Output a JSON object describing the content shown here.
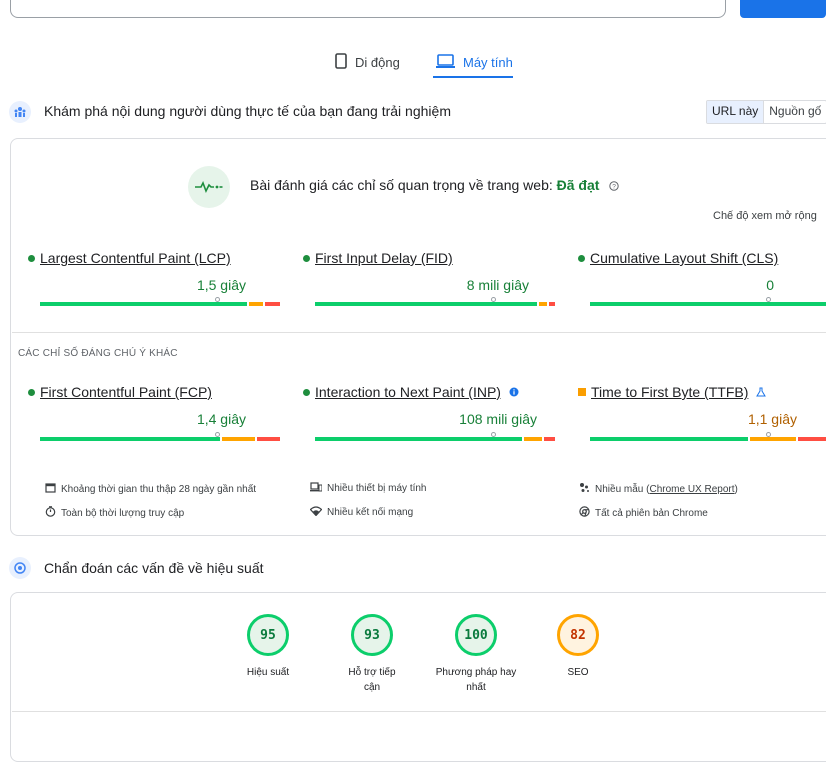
{
  "tabs": {
    "mobile": "Di động",
    "desktop": "Máy tính"
  },
  "field": {
    "heading": "Khám phá nội dung người dùng thực tế của bạn đang trải nghiệm",
    "toggle_url": "URL này",
    "toggle_origin": "Nguồn gố",
    "assessment_prefix": "Bài đánh giá các chỉ số quan trọng về trang web: ",
    "assessment_result": "Đã đạt",
    "expand_view": "Chế độ xem mở rộng",
    "other_metrics_title": "CÁC CHỈ SỐ ĐÁNG CHÚ Ý KHÁC"
  },
  "core_metrics": [
    {
      "name": "Largest Contentful Paint (LCP)",
      "value": "1,5 giây",
      "status": "good",
      "value_color": "#188038"
    },
    {
      "name": "First Input Delay (FID)",
      "value": "8 mili giây",
      "status": "good",
      "value_color": "#188038"
    },
    {
      "name": "Cumulative Layout Shift (CLS)",
      "value": "0",
      "status": "good",
      "value_color": "#188038"
    }
  ],
  "other_metrics": [
    {
      "name": "First Contentful Paint (FCP)",
      "value": "1,4 giây",
      "status": "good",
      "value_color": "#188038"
    },
    {
      "name": "Interaction to Next Paint (INP)",
      "value": "108 mili giây",
      "status": "good",
      "value_color": "#188038"
    },
    {
      "name": "Time to First Byte (TTFB)",
      "value": "1,1 giây",
      "status": "average",
      "value_color": "#b06000"
    }
  ],
  "info": {
    "period": "Khoảng thời gian thu thập 28 ngày gần nhất",
    "devices": "Nhiều thiết bị máy tính",
    "samples_prefix": "Nhiều mẫu (",
    "samples_link": "Chrome UX Report",
    "samples_suffix": ")",
    "duration": "Toàn bộ thời lượng truy cập",
    "network": "Nhiều kết nối mạng",
    "versions": "Tất cả phiên bản Chrome"
  },
  "diagnose": {
    "heading": "Chẩn đoán các vấn đề về hiệu suất"
  },
  "scores": [
    {
      "value": "95",
      "label": "Hiệu suất",
      "rating": "good"
    },
    {
      "value": "93",
      "label": "Hỗ trợ tiếp cận",
      "rating": "good"
    },
    {
      "value": "100",
      "label": "Phương pháp hay nhất",
      "rating": "good"
    },
    {
      "value": "82",
      "label": "SEO",
      "rating": "average"
    }
  ],
  "colors": {
    "accent": "#1a73e8",
    "good": "#0cce6b",
    "average": "#ffa400",
    "poor": "#ff4e42"
  },
  "icons": [
    "smartphone-icon",
    "laptop-icon",
    "people-icon",
    "heartbeat-icon",
    "help-icon",
    "info-icon",
    "flask-icon",
    "calendar-icon",
    "devices-icon",
    "samples-icon",
    "timer-icon",
    "wifi-icon",
    "chrome-icon",
    "gauge-icon"
  ]
}
